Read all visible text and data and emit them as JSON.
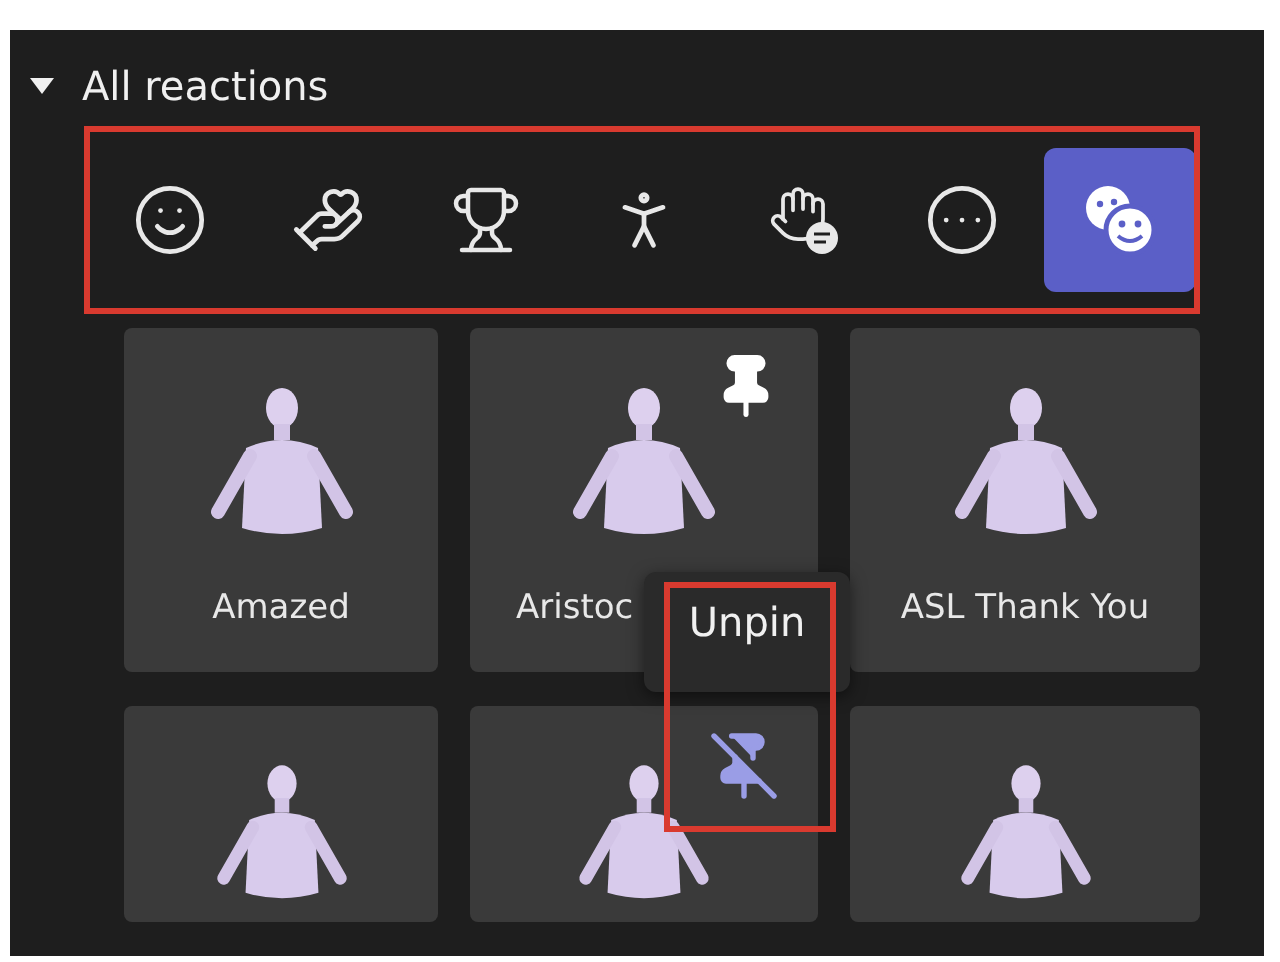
{
  "section": {
    "title": "All reactions",
    "expanded": true
  },
  "toolbar": {
    "highlighted": true,
    "items": [
      {
        "kind": "smile",
        "selected": false
      },
      {
        "kind": "hand-heart",
        "selected": false
      },
      {
        "kind": "trophy",
        "selected": false
      },
      {
        "kind": "dance",
        "selected": false
      },
      {
        "kind": "hand-chat",
        "selected": false
      },
      {
        "kind": "more",
        "selected": false
      },
      {
        "kind": "faces",
        "selected": true
      }
    ]
  },
  "reactions": [
    {
      "label": "Amazed",
      "label_cut": false,
      "pinned": false
    },
    {
      "label": "Aristoc",
      "label_cut": true,
      "pinned": true
    },
    {
      "label": "ASL Thank You",
      "label_cut": false,
      "pinned": false
    },
    {
      "pinned": false
    },
    {
      "pinned": true,
      "hovered": true
    },
    {
      "pinned": false
    }
  ],
  "tooltip": {
    "text": "Unpin",
    "highlighted": true
  }
}
